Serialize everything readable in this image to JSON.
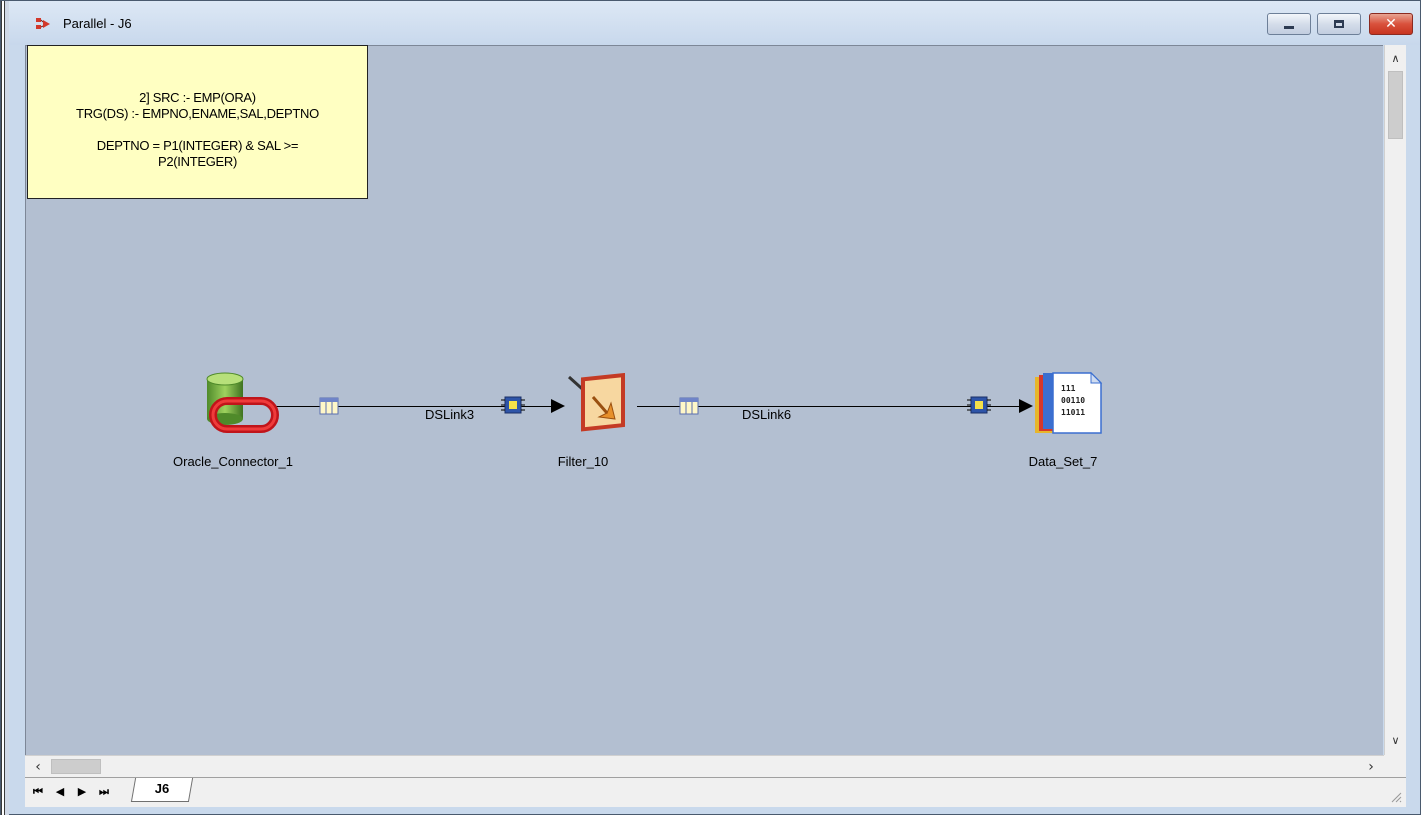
{
  "window": {
    "title": "Parallel - J6"
  },
  "annotation": {
    "lines": [
      "2] SRC :- EMP(ORA)",
      "TRG(DS) :- EMPNO,ENAME,SAL,DEPTNO",
      "",
      "DEPTNO = P1(INTEGER) & SAL >=",
      "P2(INTEGER)"
    ]
  },
  "stages": [
    {
      "id": "oracle",
      "label": "Oracle_Connector_1",
      "icon": "oracle-database-icon"
    },
    {
      "id": "filter",
      "label": "Filter_10",
      "icon": "filter-stage-icon"
    },
    {
      "id": "dataset",
      "label": "Data_Set_7",
      "icon": "dataset-file-icon"
    }
  ],
  "links": [
    {
      "label": "DSLink3",
      "from": "Oracle_Connector_1",
      "to": "Filter_10"
    },
    {
      "label": "DSLink6",
      "from": "Filter_10",
      "to": "Data_Set_7"
    }
  ],
  "tabs": [
    {
      "label": "J6",
      "active": true
    }
  ],
  "colors": {
    "canvas": "#b3bfd1",
    "note": "#ffffc2"
  }
}
